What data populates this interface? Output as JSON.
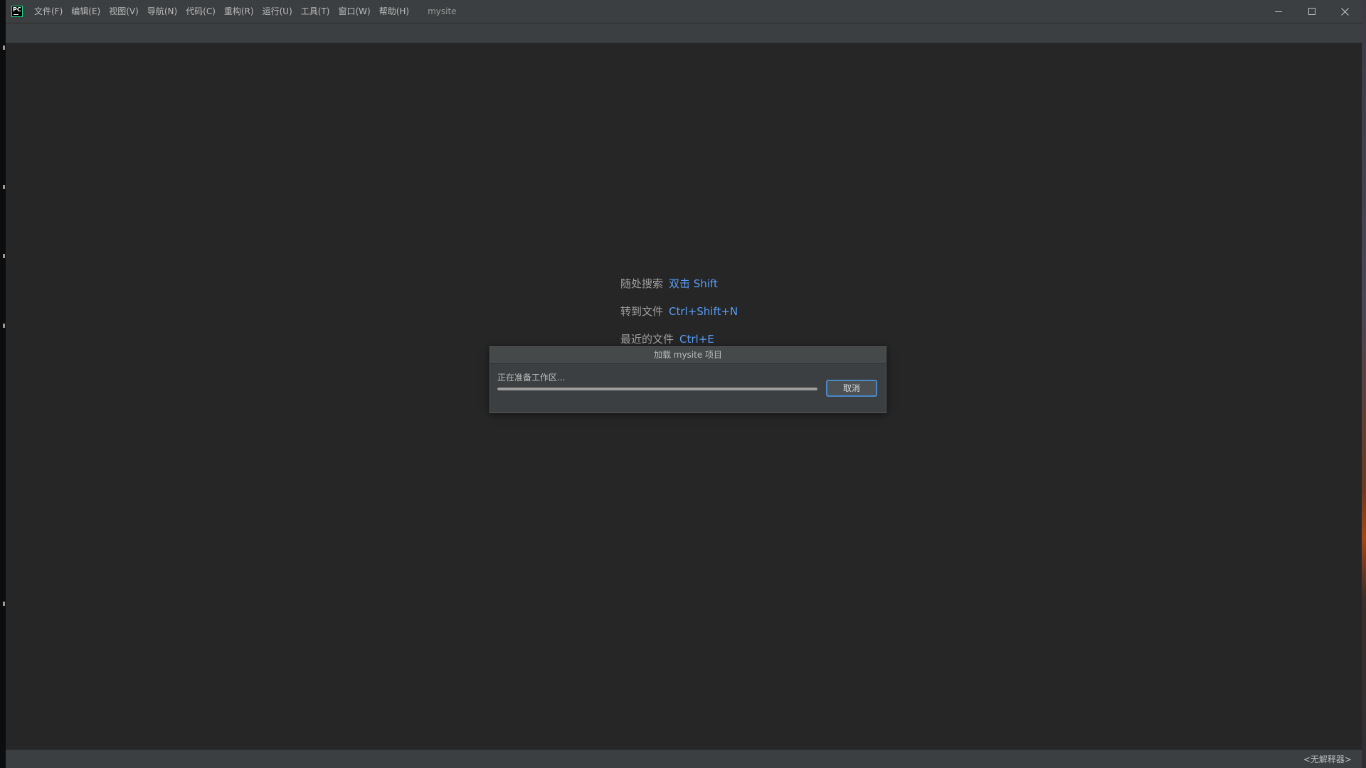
{
  "titlebar": {
    "menu": [
      "文件(F)",
      "编辑(E)",
      "视图(V)",
      "导航(N)",
      "代码(C)",
      "重构(R)",
      "运行(U)",
      "工具(T)",
      "窗口(W)",
      "帮助(H)"
    ],
    "project_title": "mysite",
    "logo_text": "PC"
  },
  "welcome_hints": [
    {
      "label": "随处搜索",
      "shortcut": "双击 Shift"
    },
    {
      "label": "转到文件",
      "shortcut": "Ctrl+Shift+N"
    },
    {
      "label": "最近的文件",
      "shortcut": "Ctrl+E"
    }
  ],
  "dialog": {
    "title": "加载 mysite 项目",
    "status": "正在准备工作区...",
    "progress": 1.0,
    "cancel_label": "取消"
  },
  "statusbar": {
    "interpreter": "<无解释器>"
  },
  "colors": {
    "shortcut": "#589df6",
    "button_focus": "#4a88c7"
  }
}
